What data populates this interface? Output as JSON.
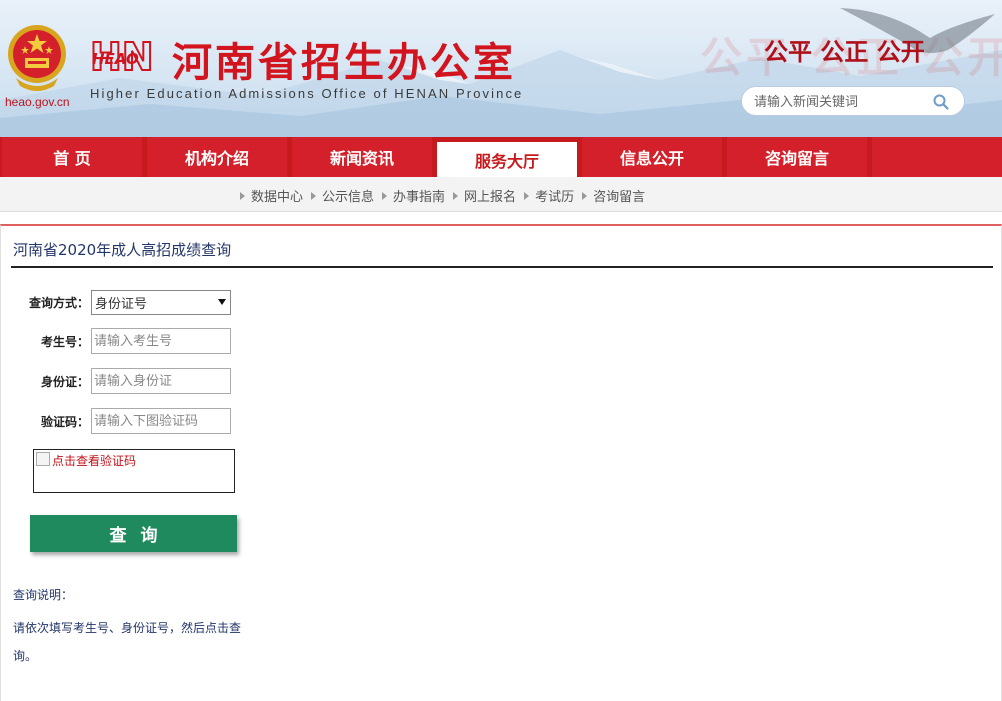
{
  "header": {
    "site_url": "heao.gov.cn",
    "logo_text": "HEAO",
    "title": "河南省招生办公室",
    "subtitle": "Higher Education Admissions Office of HENAN Province",
    "watermark": "公平 公正 公开",
    "slogan": "公平 公正 公开",
    "search": {
      "placeholder": "请输入新闻关键词"
    }
  },
  "main_nav": {
    "items": [
      {
        "label": "首  页"
      },
      {
        "label": "机构介绍"
      },
      {
        "label": "新闻资讯"
      },
      {
        "label": "服务大厅",
        "active": true
      },
      {
        "label": "信息公开"
      },
      {
        "label": "咨询留言"
      }
    ]
  },
  "sub_nav": {
    "items": [
      "数据中心",
      "公示信息",
      "办事指南",
      "网上报名",
      "考试历",
      "咨询留言"
    ]
  },
  "page": {
    "title": "河南省2020年成人高招成绩查询"
  },
  "form": {
    "query_method_label": "查询方式：",
    "query_method_value": "身份证号",
    "exam_no_label": "考生号：",
    "exam_no_placeholder": "请输入考生号",
    "id_label": "身份证：",
    "id_placeholder": "请输入身份证",
    "captcha_label": "验证码：",
    "captcha_placeholder": "请输入下图验证码",
    "captcha_image_alt": "点击查看验证码",
    "submit_label": "查询"
  },
  "notes": {
    "title": "查询说明：",
    "text": "请依次填写考生号、身份证号，然后点击查询。"
  },
  "colors": {
    "brand_red": "#c71a1f",
    "nav_red": "#d3202a",
    "title_blue": "#23366a",
    "button_green": "#1f8a5e"
  }
}
